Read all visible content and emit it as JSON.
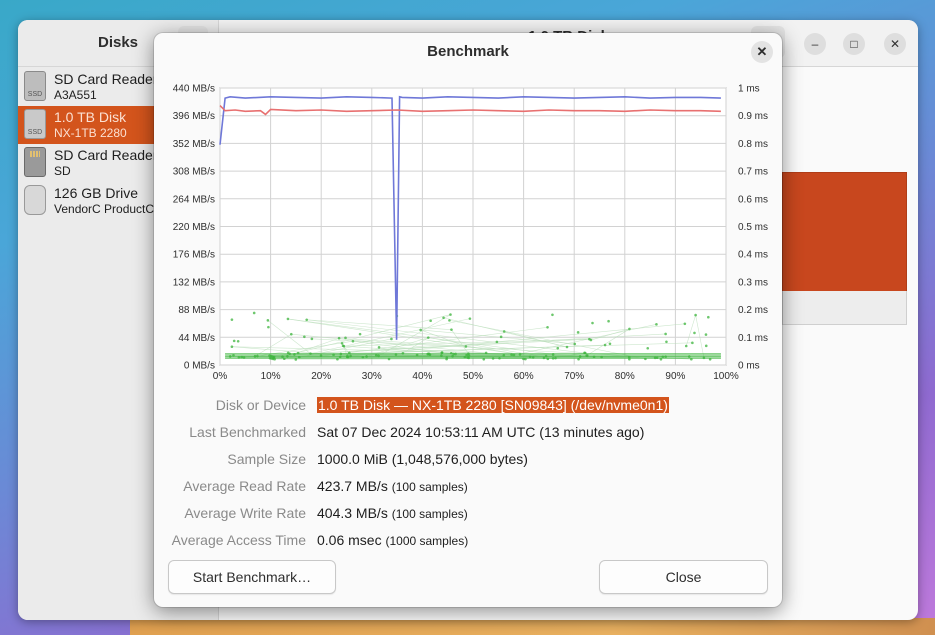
{
  "disks_window": {
    "sidebar_title": "Disks",
    "header_title": "1.0 TB Disk",
    "drives": [
      {
        "name": "SD Card Reader",
        "sub": "A3A551",
        "icon": "ssd-icon",
        "icon_label": "SSD",
        "selected": false
      },
      {
        "name": "1.0 TB Disk",
        "sub": "NX-1TB 2280",
        "icon": "ssd-icon",
        "icon_label": "SSD",
        "selected": true
      },
      {
        "name": "SD Card Reader",
        "sub": "SD",
        "icon": "sd-card-icon",
        "icon_label": "",
        "selected": false
      },
      {
        "name": "126 GB Drive",
        "sub": "VendorC ProductCode",
        "icon": "usb-drive-icon",
        "icon_label": "",
        "selected": false
      }
    ],
    "window_controls": {
      "minimize": "–",
      "maximize": "□",
      "close": "✕"
    },
    "volume_color": "#c8471e"
  },
  "dialog": {
    "title": "Benchmark",
    "close_glyph": "✕",
    "labels": {
      "disk_or_device": "Disk or Device",
      "last_benchmarked": "Last Benchmarked",
      "sample_size": "Sample Size",
      "avg_read": "Average Read Rate",
      "avg_write": "Average Write Rate",
      "avg_access": "Average Access Time"
    },
    "values": {
      "disk_or_device": "1.0 TB Disk — NX-1TB 2280 [SN09843] (/dev/nvme0n1)",
      "last_benchmarked": "Sat 07 Dec 2024 10:53:11 AM UTC (13 minutes ago)",
      "sample_size": "1000.0 MiB (1,048,576,000 bytes)",
      "avg_read": "423.7 MB/s",
      "avg_read_samples": "(100 samples)",
      "avg_write": "404.3 MB/s",
      "avg_write_samples": "(100 samples)",
      "avg_access": "0.06 msec",
      "avg_access_samples": "(1000 samples)"
    },
    "buttons": {
      "start": "Start Benchmark…",
      "close": "Close"
    }
  },
  "chart_data": {
    "type": "line",
    "x_ticks": [
      "0%",
      "10%",
      "20%",
      "30%",
      "40%",
      "50%",
      "60%",
      "70%",
      "80%",
      "90%",
      "100%"
    ],
    "y_left_ticks": [
      "0 MB/s",
      "44 MB/s",
      "88 MB/s",
      "132 MB/s",
      "176 MB/s",
      "220 MB/s",
      "264 MB/s",
      "308 MB/s",
      "352 MB/s",
      "396 MB/s",
      "440 MB/s"
    ],
    "y_right_ticks": [
      "0 ms",
      "0.1 ms",
      "0.2 ms",
      "0.3 ms",
      "0.4 ms",
      "0.5 ms",
      "0.6 ms",
      "0.7 ms",
      "0.8 ms",
      "0.9 ms",
      "1 ms"
    ],
    "x_range": [
      0,
      100
    ],
    "y_left_range": [
      0,
      440
    ],
    "y_right_range": [
      0,
      1
    ],
    "grid": true,
    "series": [
      {
        "color": "#6f78d8",
        "x": [
          0,
          1,
          2,
          5,
          10,
          15,
          20,
          25,
          30,
          34,
          34.9,
          35.5,
          36,
          40,
          45,
          50,
          55,
          60,
          65,
          70,
          75,
          80,
          85,
          90,
          95,
          99
        ],
        "values": [
          350,
          424,
          426,
          424,
          426,
          425,
          424,
          426,
          425,
          424,
          40,
          426,
          425,
          424,
          426,
          425,
          424,
          426,
          425,
          424,
          425,
          426,
          424,
          425,
          425,
          424
        ]
      },
      {
        "color": "#e87070",
        "x": [
          0,
          1,
          3,
          5,
          8,
          9,
          10,
          15,
          20,
          25,
          30,
          35,
          40,
          45,
          50,
          55,
          60,
          65,
          70,
          75,
          80,
          85,
          90,
          95,
          99
        ],
        "values": [
          412,
          404,
          405,
          403,
          404,
          398,
          406,
          404,
          405,
          403,
          404,
          405,
          403,
          404,
          405,
          404,
          403,
          405,
          404,
          404,
          403,
          405,
          404,
          404,
          403
        ]
      }
    ],
    "access_time_color": "#3cb43c",
    "access_time_range_ms": [
      0.02,
      0.19
    ]
  }
}
